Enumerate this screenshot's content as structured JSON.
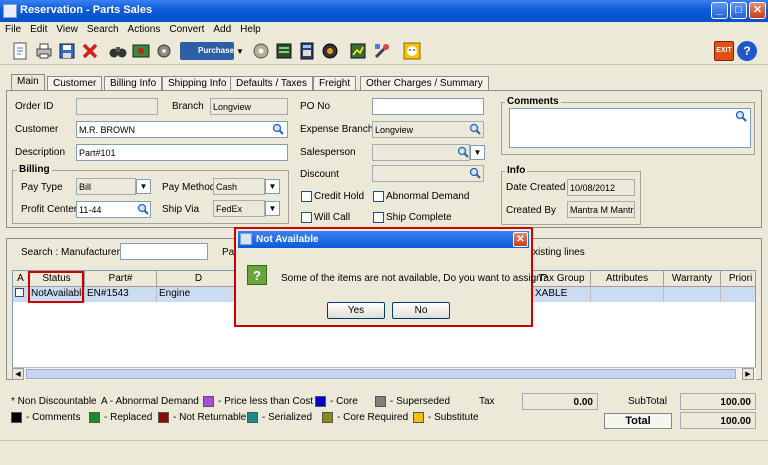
{
  "window": {
    "title": "Reservation - Parts Sales",
    "min": "_",
    "max": "□",
    "close": "✕"
  },
  "menu": [
    "File",
    "Edit",
    "View",
    "Search",
    "Actions",
    "Convert",
    "Add",
    "Help"
  ],
  "toolbar": {
    "purchase_label": "Purchase",
    "exit_label": "EXIT",
    "help_label": "?"
  },
  "tabs": [
    "Main",
    "Customer",
    "Billing Info",
    "Shipping Info",
    "Defaults / Taxes",
    "Freight",
    "Other Charges / Summary"
  ],
  "form": {
    "order_id_label": "Order ID",
    "order_id_value": "",
    "branch_label": "Branch",
    "branch_value": "Longview",
    "po_label": "PO No",
    "po_value": "",
    "comments_label": "Comments",
    "customer_label": "Customer",
    "customer_value": "M.R. BROWN",
    "expense_branch_label": "Expense Branch",
    "expense_branch_value": "Longview",
    "description_label": "Description",
    "description_value": "Part#101",
    "salesperson_label": "Salesperson",
    "salesperson_value": "",
    "billing_label": "Billing",
    "pay_type_label": "Pay Type",
    "pay_type_value": "Bill",
    "pay_method_label": "Pay Method",
    "pay_method_value": "Cash",
    "discount_label": "Discount",
    "discount_value": "",
    "credit_hold_label": "Credit Hold",
    "abnormal_demand_label": "Abnormal Demand",
    "profit_center_label": "Profit Center",
    "profit_center_value": "11-44",
    "ship_via_label": "Ship Via",
    "ship_via_value": "FedEx",
    "will_call_label": "Will Call",
    "ship_complete_label": "Ship Complete",
    "info_label": "Info",
    "date_created_label": "Date Created",
    "date_created_value": "10/08/2012",
    "created_by_label": "Created By",
    "created_by_value": "Mantra M Mantra"
  },
  "search": {
    "label": "Search :",
    "manufacturer_label": "Manufacturer",
    "manufacturer_value": "",
    "pa_fragment": "Pa",
    "existing_lines_fragment": "xisting lines"
  },
  "grid": {
    "headers": {
      "a": "A",
      "status": "Status",
      "part": "Part#",
      "desc": "D",
      "tax_group": "Tax Group",
      "attributes": "Attributes",
      "warranty": "Warranty",
      "priority": "Priori"
    },
    "row": {
      "status": "NotAvailable",
      "part": "EN#1543",
      "desc": "Engine",
      "tax": "XABLE"
    }
  },
  "legend": {
    "non_discountable": "* Non Discountable",
    "abnormal": "A - Abnormal Demand",
    "price_less": "- Price less than Cost",
    "core": "- Core",
    "superseded": "- Superseded",
    "comments": "- Comments",
    "replaced": "- Replaced",
    "not_returnable": "- Not Returnable",
    "serialized": "- Serialized",
    "core_required": "- Core Required",
    "substitute": "- Substitute",
    "colors": {
      "purple": "#a64ddb",
      "blue": "#0000cc",
      "gray": "#808080",
      "black": "#000000",
      "green": "#1a8c2a",
      "maroon": "#8b0a0a",
      "teal": "#1a8c8c",
      "olive": "#8c8c14",
      "yellow": "#f0c010"
    }
  },
  "totals": {
    "tax_label": "Tax",
    "tax_value": "0.00",
    "subtotal_label": "SubTotal",
    "subtotal_value": "100.00",
    "total_label": "Total",
    "total_value": "100.00"
  },
  "dialog": {
    "title": "Not Available",
    "message": "Some of the items are not available, Do you want to assign?",
    "yes": "Yes",
    "no": "No",
    "icon": "?"
  }
}
